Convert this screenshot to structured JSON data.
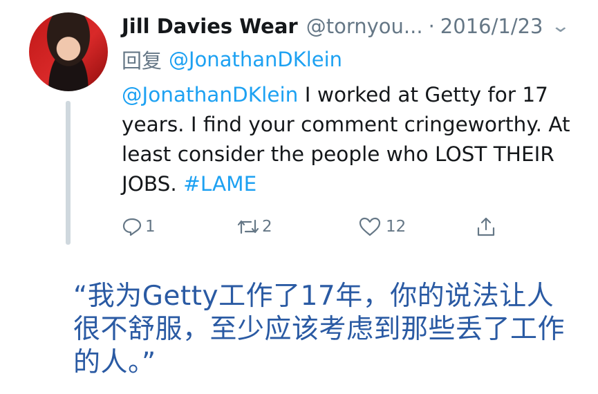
{
  "tweet": {
    "author_name": "Jill Davies Wear",
    "handle": "@tornyou...",
    "separator": "·",
    "date": "2016/1/23",
    "reply_label": "回复",
    "reply_to": "@JonathanDKlein",
    "body_mention": "@JonathanDKlein",
    "body_text": " I worked at Getty for 17 years. I find your comment cringeworthy. At least consider the people who LOST THEIR JOBS. ",
    "hashtag": "#LAME",
    "replies": "1",
    "retweets": "2",
    "likes": "12",
    "icons": {
      "menu": "chevron-down-icon",
      "reply": "reply-icon",
      "retweet": "retweet-icon",
      "like": "heart-icon",
      "share": "share-icon"
    }
  },
  "caption": "“我为Getty工作了17年，你的说法让人很不舒服，至少应该考虑到那些丢了工作的人。”",
  "colors": {
    "link": "#1da1f2",
    "muted": "#657786",
    "caption": "#2a5aa3",
    "thread_line": "#cfd8de"
  }
}
